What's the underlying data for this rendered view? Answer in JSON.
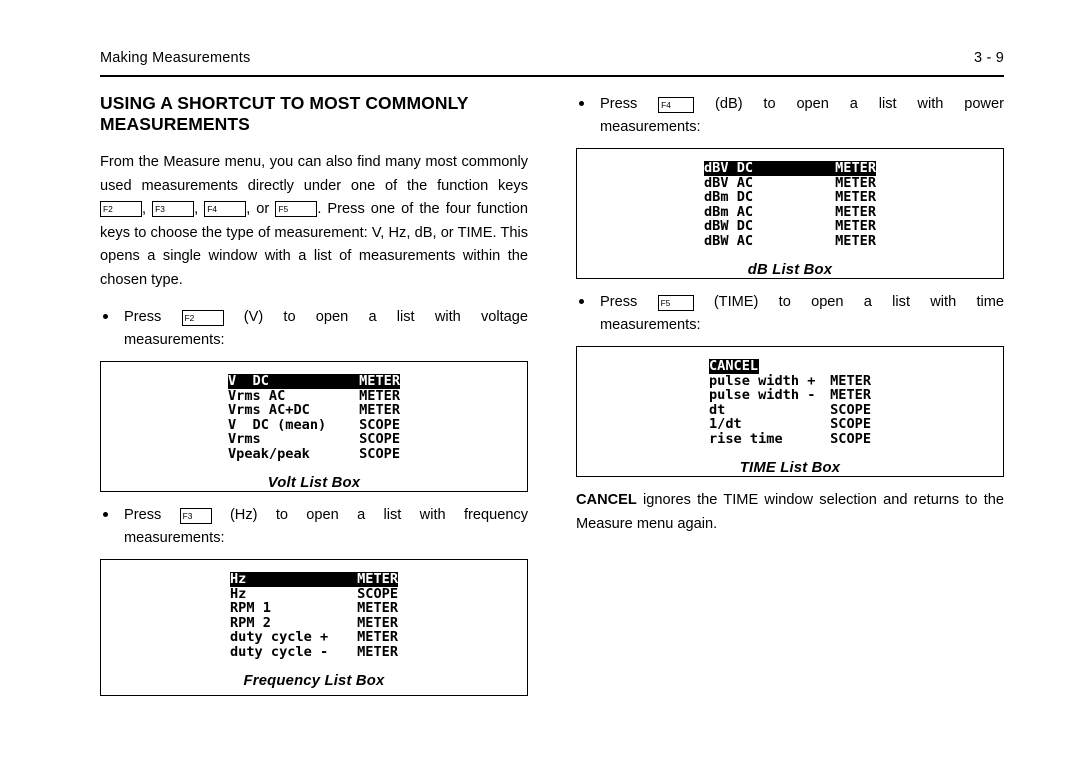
{
  "header": {
    "chapter_title": "Making Measurements",
    "page_number": "3 - 9"
  },
  "section": {
    "title": "USING A SHORTCUT TO MOST COMMONLY MEASUREMENTS",
    "intro_part1": "From the Measure menu, you can also find many most commonly used measurements directly under one of the function keys",
    "intro_sep1": ",",
    "intro_sep2": ",",
    "intro_or": ", or",
    "intro_part2": ". Press one of the four function keys to choose the type of measurement: V, Hz, dB, or TIME. This opens a single window with a list of measurements within the chosen type."
  },
  "fkeys": {
    "f2": "F2",
    "f3": "F3",
    "f4": "F4",
    "f5": "F5"
  },
  "bullets": {
    "volt": {
      "press": "Press",
      "key": "F2",
      "paren": "(V)",
      "w1": "to",
      "w2": "open",
      "w3": "a",
      "w4": "list",
      "w5": "with",
      "w6": "voltage",
      "line2": "measurements:"
    },
    "freq": {
      "press": "Press",
      "key": "F3",
      "paren": "(Hz)",
      "w1": "to",
      "w2": "open",
      "w3": "a",
      "w4": "list",
      "w5": "with",
      "w6": "frequency",
      "line2": "measurements:"
    },
    "db": {
      "press": "Press",
      "key": "F4",
      "paren": "(dB)",
      "w1": "to",
      "w2": "open",
      "w3": "a",
      "w4": "list",
      "w5": "with",
      "w6": "power",
      "line2": "measurements:"
    },
    "time": {
      "press": "Press",
      "key": "F5",
      "paren": "(TIME)",
      "w1": "to",
      "w2": "open",
      "w3": "a",
      "w4": "list",
      "w5": "with",
      "w6": "time",
      "line2": "measurements:"
    }
  },
  "list_boxes": {
    "volt": {
      "caption": "Volt List Box",
      "rows": [
        {
          "label": "V  DC",
          "mode": "METER",
          "selected": true
        },
        {
          "label": "Vrms AC",
          "mode": "METER",
          "selected": false
        },
        {
          "label": "Vrms AC+DC",
          "mode": "METER",
          "selected": false
        },
        {
          "label": "V  DC (mean)",
          "mode": "SCOPE",
          "selected": false
        },
        {
          "label": "Vrms",
          "mode": "SCOPE",
          "selected": false
        },
        {
          "label": "Vpeak/peak",
          "mode": "SCOPE",
          "selected": false
        }
      ]
    },
    "frequency": {
      "caption": "Frequency List Box",
      "rows": [
        {
          "label": "Hz",
          "mode": "METER",
          "selected": true
        },
        {
          "label": "Hz",
          "mode": "SCOPE",
          "selected": false
        },
        {
          "label": "RPM 1",
          "mode": "METER",
          "selected": false
        },
        {
          "label": "RPM 2",
          "mode": "METER",
          "selected": false
        },
        {
          "label": "duty cycle +",
          "mode": "METER",
          "selected": false
        },
        {
          "label": "duty cycle -",
          "mode": "METER",
          "selected": false
        }
      ]
    },
    "db": {
      "caption": "dB List Box",
      "rows": [
        {
          "label": "dBV DC",
          "mode": "METER",
          "selected": true
        },
        {
          "label": "dBV AC",
          "mode": "METER",
          "selected": false
        },
        {
          "label": "dBm DC",
          "mode": "METER",
          "selected": false
        },
        {
          "label": "dBm AC",
          "mode": "METER",
          "selected": false
        },
        {
          "label": "dBW DC",
          "mode": "METER",
          "selected": false
        },
        {
          "label": "dBW AC",
          "mode": "METER",
          "selected": false
        }
      ]
    },
    "time": {
      "caption": "TIME List Box",
      "rows": [
        {
          "label": "CANCEL",
          "mode": "",
          "selected": true,
          "fit": true
        },
        {
          "label": "pulse width +",
          "mode": "METER",
          "selected": false
        },
        {
          "label": "pulse width -",
          "mode": "METER",
          "selected": false
        },
        {
          "label": "dt",
          "mode": "SCOPE",
          "selected": false
        },
        {
          "label": "1/dt",
          "mode": "SCOPE",
          "selected": false
        },
        {
          "label": "rise time",
          "mode": "SCOPE",
          "selected": false
        }
      ]
    }
  },
  "cancel_note": {
    "bold": "CANCEL",
    "rest": " ignores the TIME window selection and returns to the Measure menu again."
  }
}
